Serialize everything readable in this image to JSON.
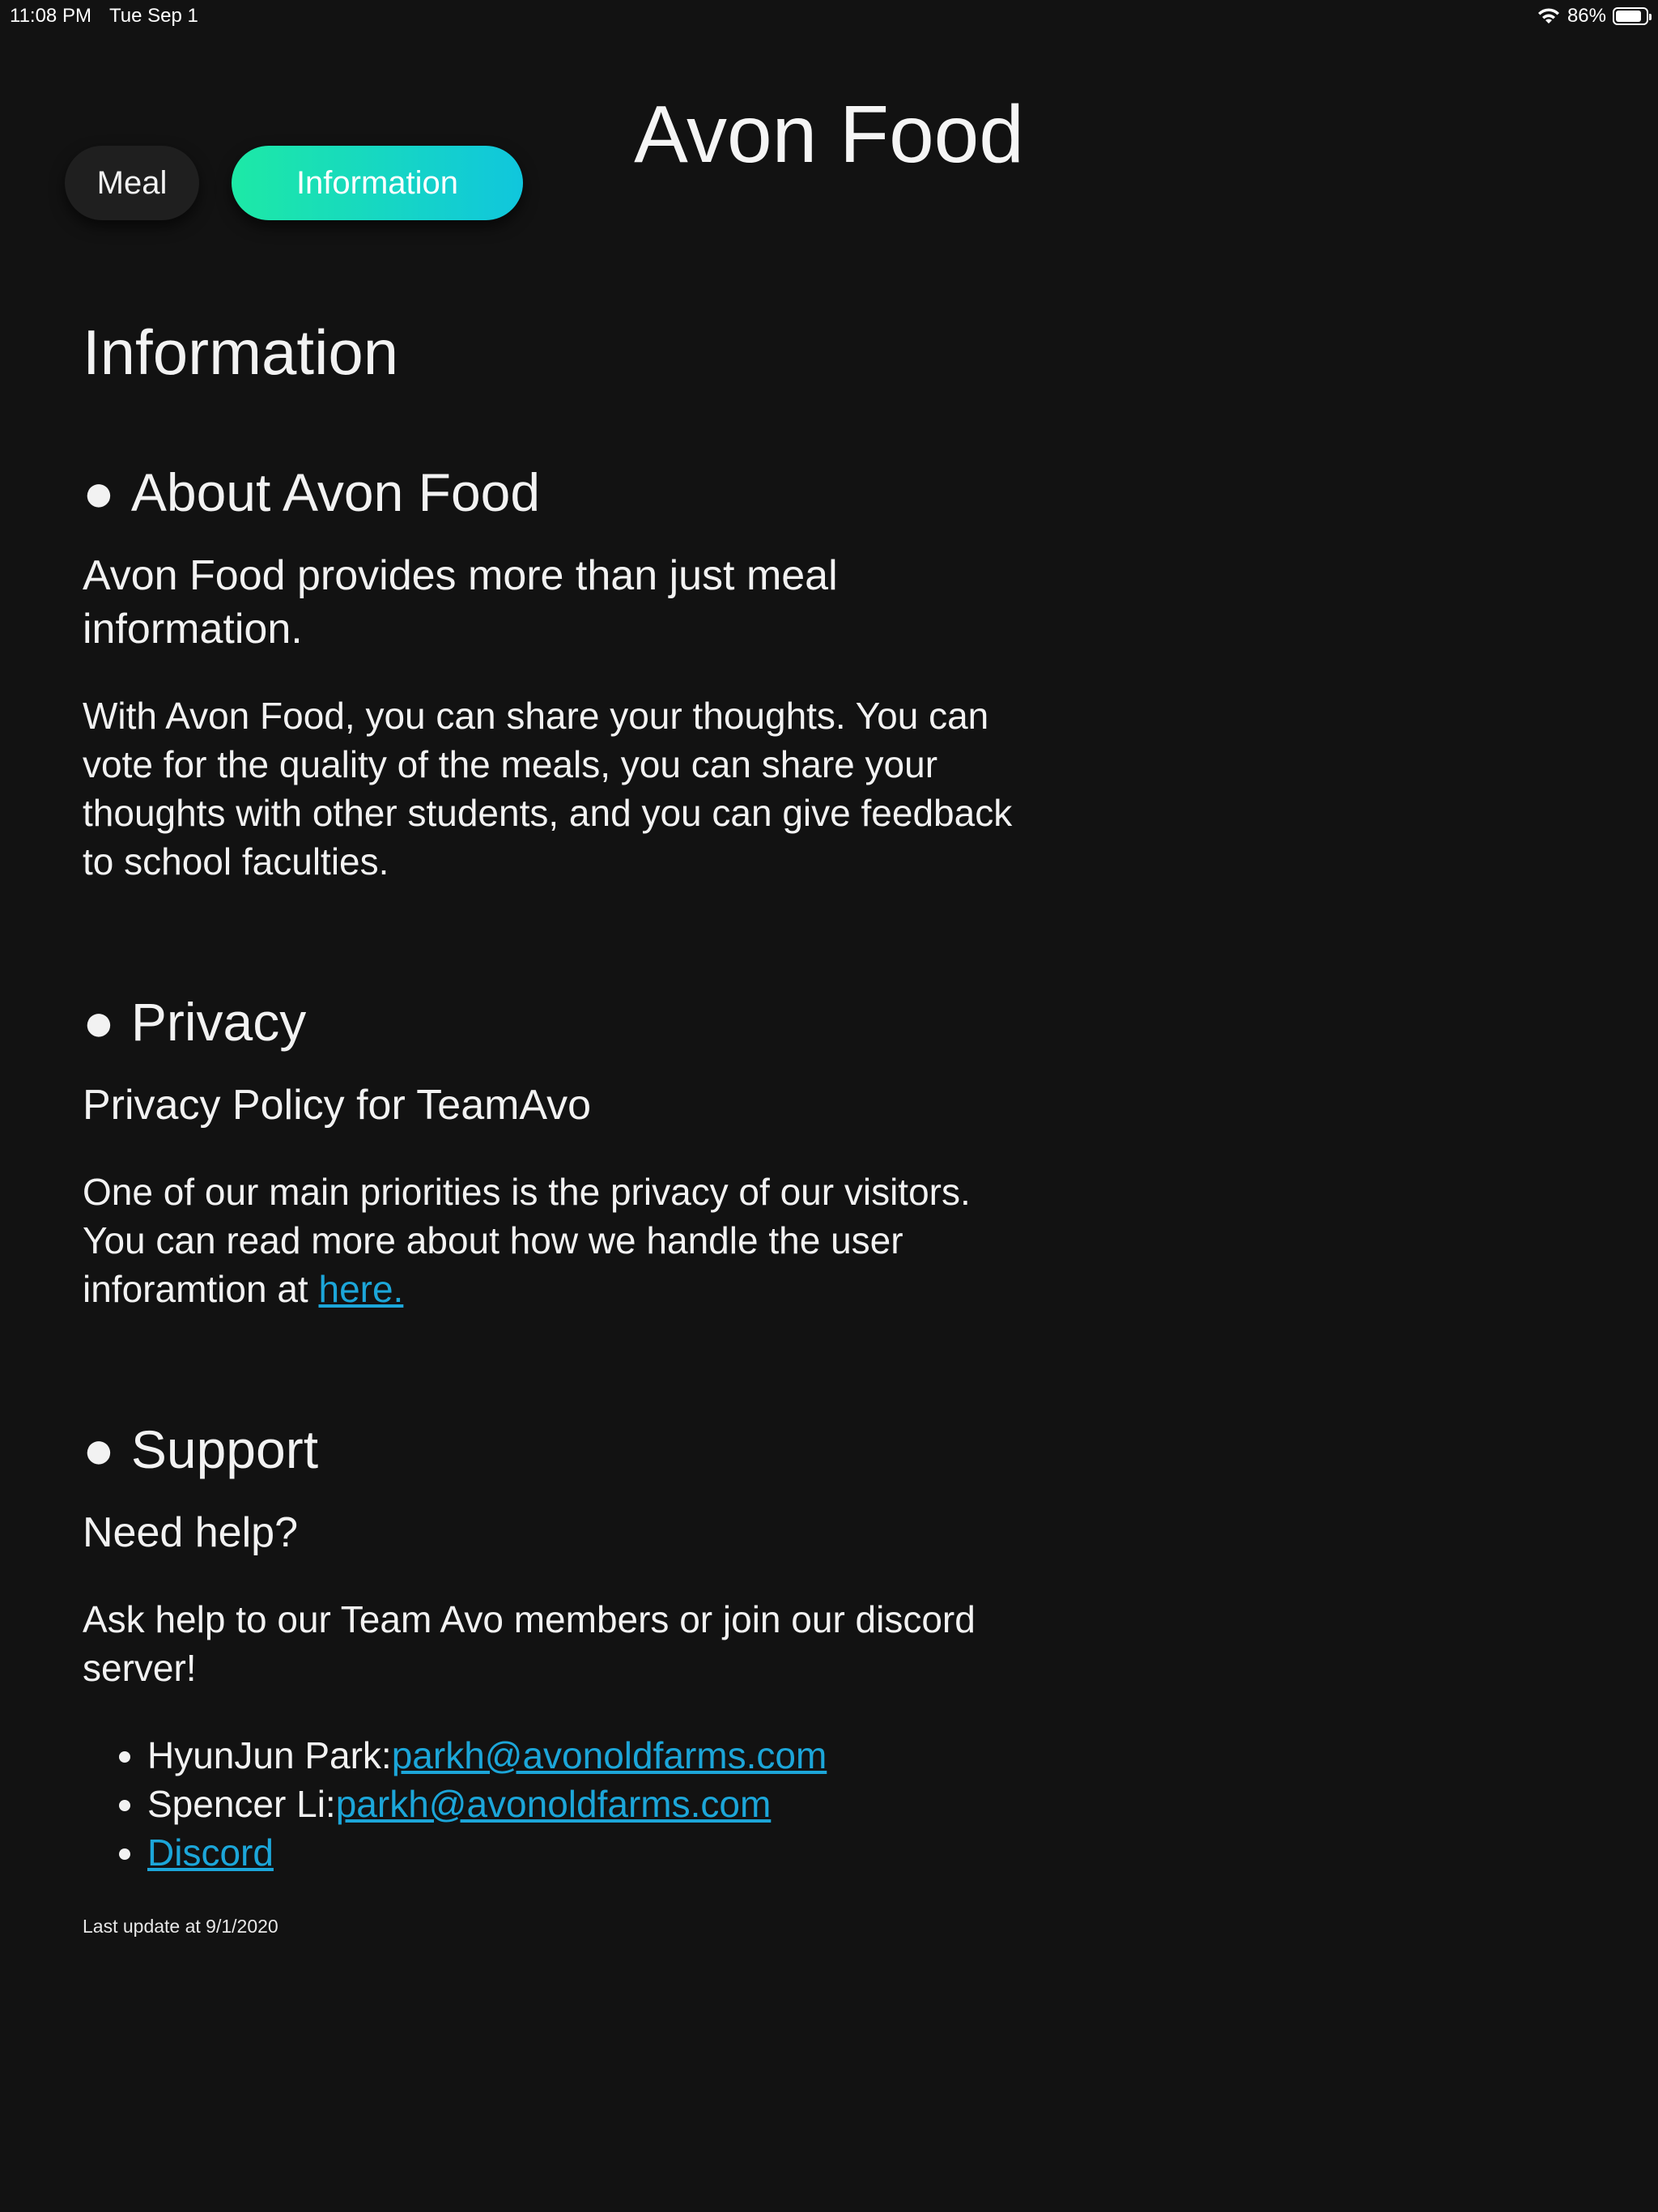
{
  "status_bar": {
    "time": "11:08 PM",
    "date": "Tue Sep 1",
    "battery_percent": "86%",
    "battery_level": 0.86
  },
  "app": {
    "title": "Avon Food"
  },
  "tabs": [
    {
      "label": "Meal",
      "active": false
    },
    {
      "label": "Information",
      "active": true
    }
  ],
  "colors": {
    "background": "#121212",
    "accent_gradient_start": "#1de9a6",
    "accent_gradient_end": "#10c6dd",
    "link": "#1ca6d9"
  },
  "page": {
    "title": "Information",
    "bullet": "●",
    "about": {
      "heading": "About Avon Food",
      "subheading": "Avon Food provides more than just meal information.",
      "body": "With Avon Food, you can share your thoughts. You can vote for the quality of the meals, you can share your thoughts with other students, and you can give feedback to school faculties."
    },
    "privacy": {
      "heading": "Privacy",
      "subheading": "Privacy Policy for TeamAvo",
      "body": "One of our main priorities is the privacy of our visitors. You can read more about how we handle the user inforamtion at ",
      "link_text": "here."
    },
    "support": {
      "heading": "Support",
      "subheading": "Need help?",
      "body": "Ask help to our Team Avo members or join our discord server!",
      "contacts": [
        {
          "name": "HyunJun Park:",
          "email": "parkh@avonoldfarms.com"
        },
        {
          "name": "Spencer Li:",
          "email": "parkh@avonoldfarms.com"
        }
      ],
      "discord_label": "Discord"
    },
    "footer": "Last update at 9/1/2020"
  }
}
